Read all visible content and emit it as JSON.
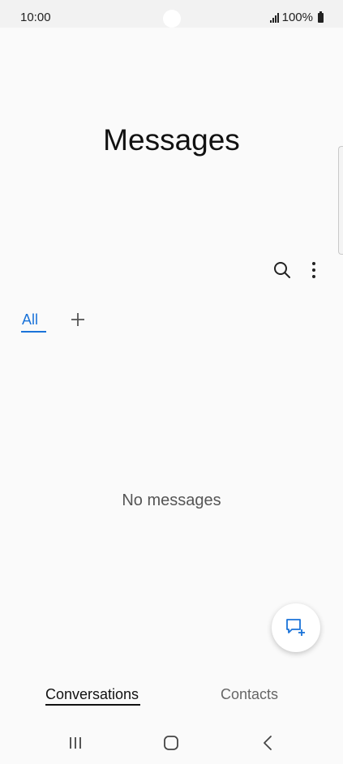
{
  "status_bar": {
    "time": "10:00",
    "battery": "100%",
    "icons": [
      "signal-icon",
      "battery-icon"
    ]
  },
  "header": {
    "title": "Messages"
  },
  "toolbar": {
    "icons": [
      "search-icon",
      "more-options-icon"
    ]
  },
  "category_tabs": {
    "all_label": "All",
    "add_icon": "plus-icon"
  },
  "empty_state": {
    "text": "No messages"
  },
  "fab": {
    "icon": "compose-message-icon"
  },
  "bottom_tabs": {
    "conversations_label": "Conversations",
    "contacts_label": "Contacts"
  },
  "nav_bar": {
    "icons": [
      "recent-apps-icon",
      "home-icon",
      "back-icon"
    ]
  },
  "colors": {
    "accent": "#1a73d9",
    "background": "#fafafa",
    "text_primary": "#111111",
    "text_secondary": "#666666"
  }
}
